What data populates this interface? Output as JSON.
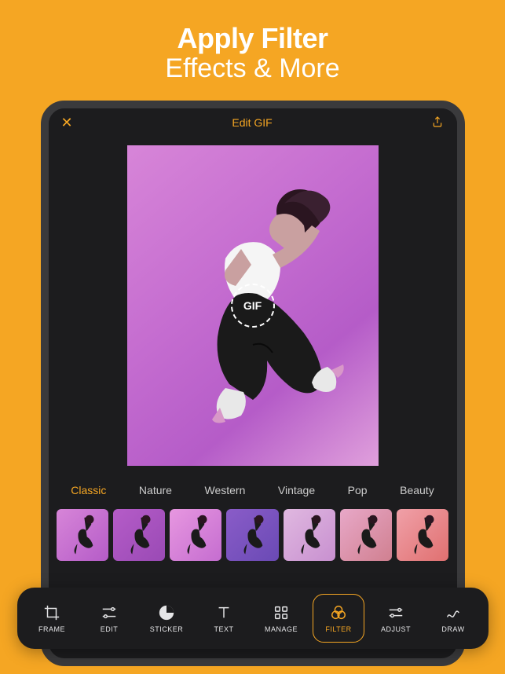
{
  "headline": {
    "line1": "Apply Filter",
    "line2": "Effects & More"
  },
  "topbar": {
    "title": "Edit GIF"
  },
  "gif_badge": "GIF",
  "filter_categories": [
    {
      "label": "Classic",
      "active": true
    },
    {
      "label": "Nature",
      "active": false
    },
    {
      "label": "Western",
      "active": false
    },
    {
      "label": "Vintage",
      "active": false
    },
    {
      "label": "Pop",
      "active": false
    },
    {
      "label": "Beauty",
      "active": false
    }
  ],
  "tools": [
    {
      "label": "FRAME",
      "key": "frame",
      "active": false
    },
    {
      "label": "EDIT",
      "key": "edit",
      "active": false
    },
    {
      "label": "STICKER",
      "key": "sticker",
      "active": false
    },
    {
      "label": "TEXT",
      "key": "text",
      "active": false
    },
    {
      "label": "MANAGE",
      "key": "manage",
      "active": false
    },
    {
      "label": "FILTER",
      "key": "filter",
      "active": true
    },
    {
      "label": "ADJUST",
      "key": "adjust",
      "active": false
    },
    {
      "label": "DRAW",
      "key": "draw",
      "active": false
    }
  ],
  "colors": {
    "accent": "#f5a623",
    "bg": "#1c1c1e"
  }
}
